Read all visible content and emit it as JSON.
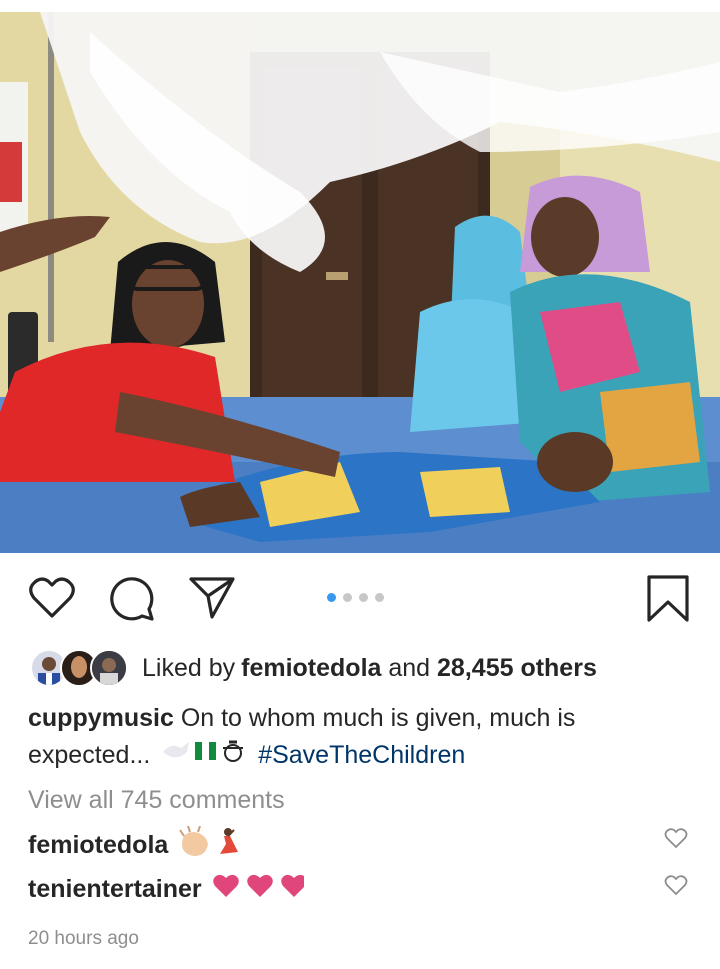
{
  "post": {
    "image_alt": "",
    "carousel": {
      "count": 4,
      "active_index": 0
    }
  },
  "likes": {
    "prefix": "Liked by ",
    "user": "femiotedola",
    "middle": " and ",
    "count": "28,455 others"
  },
  "caption": {
    "username": "cuppymusic",
    "text": " On to whom much is given, much is expected... ",
    "hashtag": "#SaveTheChildren"
  },
  "view_all": "View all 745 comments",
  "comments": [
    {
      "username": "femiotedola"
    },
    {
      "username": "tenientertainer"
    }
  ],
  "timestamp": "20 hours ago",
  "colors": {
    "accent_dot": "#3897f0",
    "hashtag": "#003569",
    "muted": "#8e8e8e",
    "heart_emoji": "#e0457b"
  },
  "icons": [
    "heart-icon",
    "comment-icon",
    "share-icon",
    "bookmark-icon"
  ]
}
